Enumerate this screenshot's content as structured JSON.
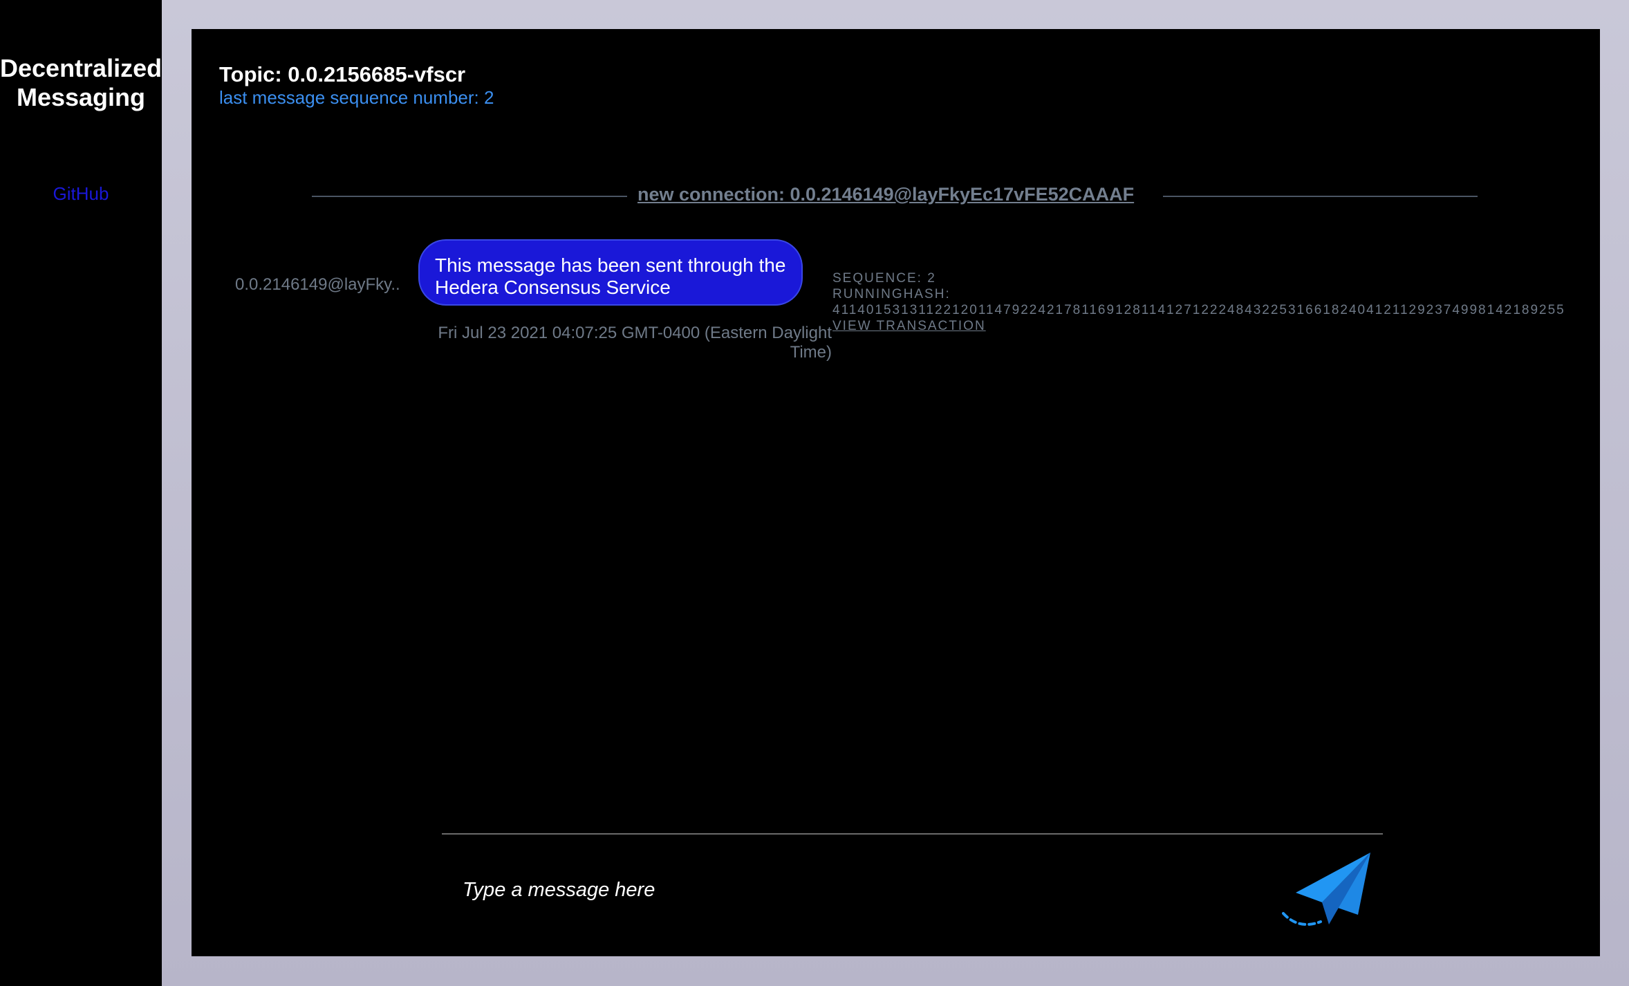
{
  "sidebar": {
    "app_title": "Decentralized Messaging",
    "github_label": "GitHub"
  },
  "header": {
    "topic_title": "Topic: 0.0.2156685-vfscr",
    "sequence_info": "last message sequence number: 2"
  },
  "connection": {
    "label": "new connection: 0.0.2146149@layFkyEc17vFE52CAAAF"
  },
  "messages": [
    {
      "sender": "0.0.2146149@layFky..",
      "text": "This message has been sent through the Hedera Consensus Service",
      "timestamp": "Fri Jul 23 2021 04:07:25 GMT-0400 (Eastern Daylight Time)",
      "sequence": "SEQUENCE: 2",
      "running_hash_label": "RUNNINGHASH:",
      "running_hash": "4114015313112212011479224217811691281141271222484322531661824041211292374998142189255",
      "view_transaction": "VIEW TRANSACTION"
    }
  ],
  "composer": {
    "placeholder": "Type a message here"
  },
  "colors": {
    "bubble": "#1a18d8",
    "accent_blue": "#3b8ff0",
    "send_icon": "#2196f3"
  }
}
